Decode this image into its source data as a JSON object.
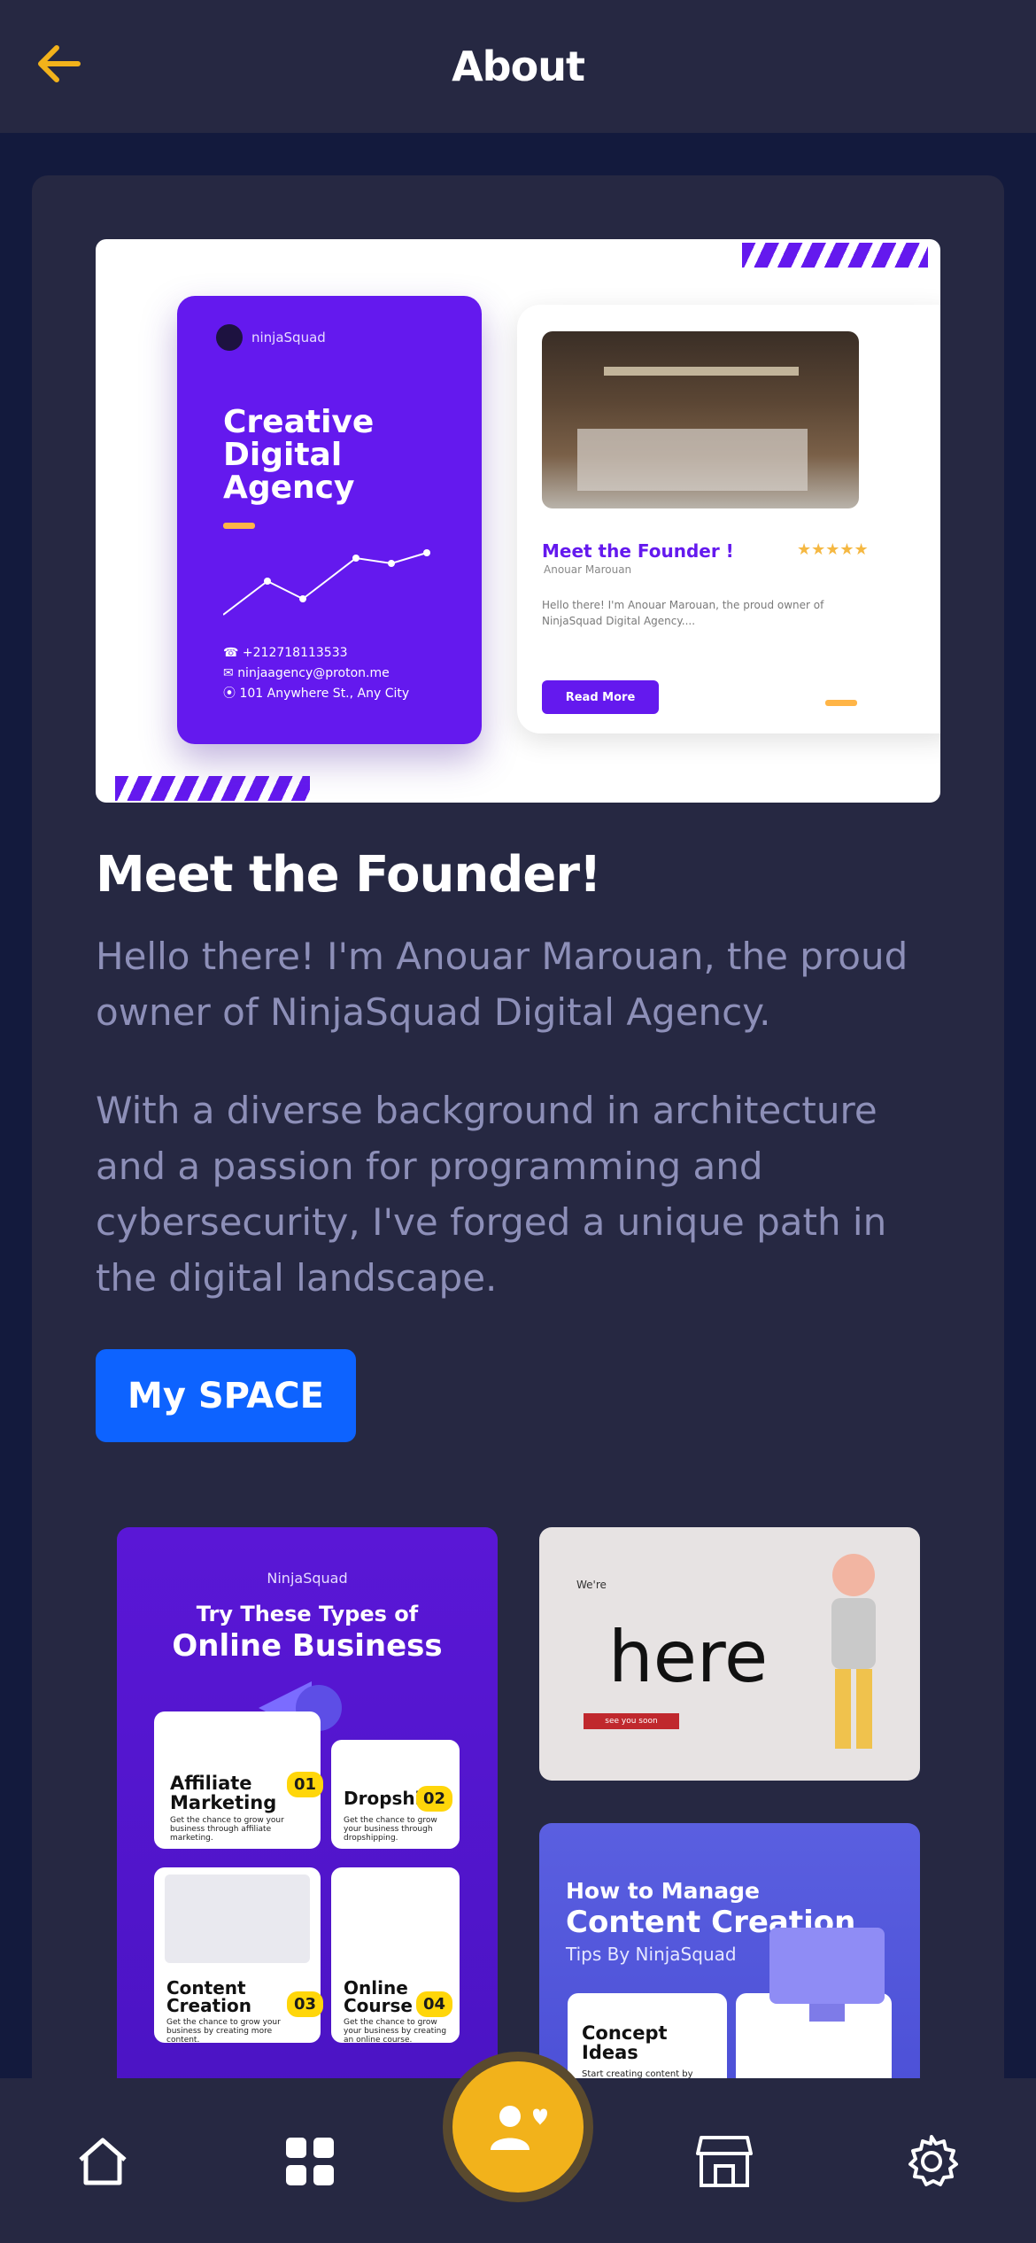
{
  "header": {
    "title": "About"
  },
  "hero": {
    "brand": "ninjaSquad",
    "headline_lines": [
      "Creative",
      "Digital",
      "Agency"
    ],
    "phone": "+212718113533",
    "email": "ninjaagency@proton.me",
    "address": "101 Anywhere St., Any City",
    "card_title": "Meet the Founder !",
    "card_name": "Anouar Marouan",
    "card_text": "Hello there! I'm Anouar Marouan, the proud owner of NinjaSquad Digital Agency....",
    "card_button": "Read More",
    "rating_stars": "★★★★★"
  },
  "founder": {
    "title": "Meet the Founder!",
    "para1": "Hello there! I'm Anouar Marouan, the proud owner of NinjaSquad Digital Agency.",
    "para2": "With a diverse background in architecture and a passion for programming and cybersecurity, I've forged a unique path in the digital landscape.",
    "button": "My SPACE"
  },
  "gallery": {
    "poster1": {
      "brand": "NinjaSquad",
      "line1": "Try These Types of",
      "line2": "Online Business",
      "items": [
        {
          "title": "Affiliate Marketing",
          "num": "01",
          "desc": "Get the chance to grow your business through affiliate marketing."
        },
        {
          "title": "Dropship",
          "num": "02",
          "desc": "Get the chance to grow your business through dropshipping."
        },
        {
          "title": "Content Creation",
          "num": "03",
          "desc": "Get the chance to grow your business by creating more content."
        },
        {
          "title": "Online Course",
          "num": "04",
          "desc": "Get the chance to grow your business by creating an online course."
        }
      ]
    },
    "poster2": {
      "small": "We're",
      "big": "here",
      "tag": "see you soon"
    },
    "poster3": {
      "line1": "How to Manage",
      "line2": "Content Creation",
      "line3": "Tips By NinjaSquad",
      "card_title": "Concept Ideas",
      "card_text": "Start creating content by brainstorming ideas"
    }
  },
  "nav": {
    "items": [
      "home-icon",
      "grid-icon",
      "users-heart-icon",
      "store-icon",
      "gear-icon"
    ]
  },
  "colors": {
    "background": "#131a3d",
    "surface": "#262842",
    "accent": "#f2b21b",
    "primary_button": "#0d63ff",
    "text_muted": "#8d8fb8",
    "brand_purple": "#6419ee"
  }
}
